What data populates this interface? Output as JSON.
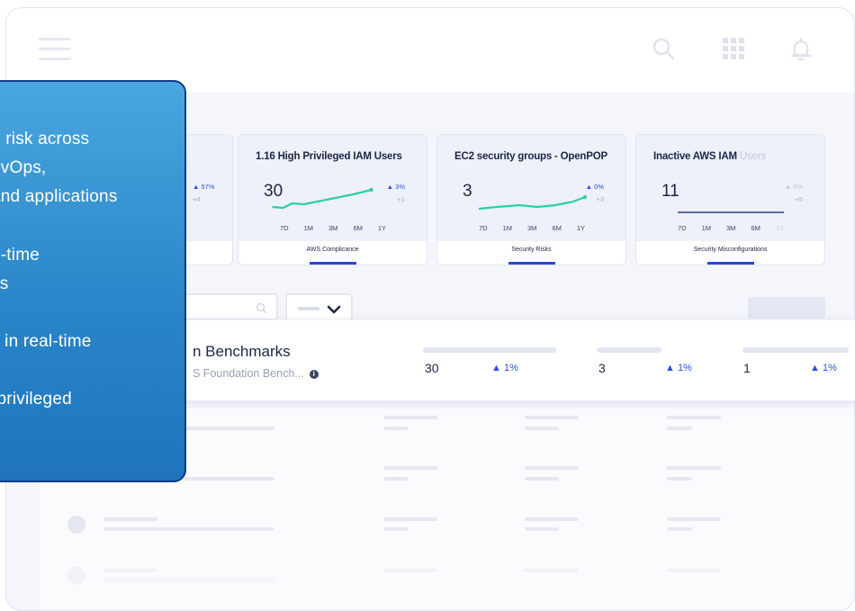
{
  "overlay": {
    "lines": [
      "e risk across",
      "evOps,",
      "and applications",
      "n-time",
      "ss",
      "y in real-time",
      "-privileged"
    ]
  },
  "cards": [
    {
      "title_bold": "1.16 High Privileged IAM Users",
      "title_light": "",
      "value": "30",
      "delta": "3%",
      "delta_sub": "+1",
      "periods": [
        "7D",
        "1M",
        "3M",
        "6M",
        "1Y"
      ],
      "footer": "AWS Complicance"
    },
    {
      "title_bold": "EC2 security groups - OpenPOP",
      "title_light": "",
      "value": "3",
      "delta": "0%",
      "delta_sub": "+3",
      "periods": [
        "7D",
        "1M",
        "3M",
        "6M",
        "1Y"
      ],
      "footer": "Security Risks"
    },
    {
      "title_bold": "Inactive AWS IAM",
      "title_light": " Users",
      "value": "11",
      "delta": "0%",
      "delta_sub": "+5",
      "periods": [
        "7D",
        "1M",
        "3M",
        "6M",
        "1Y"
      ],
      "footer": "Security Misconfigurations"
    }
  ],
  "stub_card": {
    "delta": "57%",
    "delta_sub": "+4"
  },
  "benchmark": {
    "title": "n Benchmarks",
    "subtitle": "S Foundation Bench...",
    "metrics": [
      {
        "value": "30",
        "change": "1%"
      },
      {
        "value": "3",
        "change": "1%"
      },
      {
        "value": "1",
        "change": "1%"
      }
    ]
  },
  "colors": {
    "accent": "#2b4ee3",
    "spark": "#2ecfa6",
    "overlay": "#2a86c8",
    "text": "#1c2547"
  },
  "icons": [
    "hamburger-icon",
    "search-icon",
    "apps-grid-icon",
    "bell-icon",
    "info-icon",
    "chevron-down-icon"
  ]
}
